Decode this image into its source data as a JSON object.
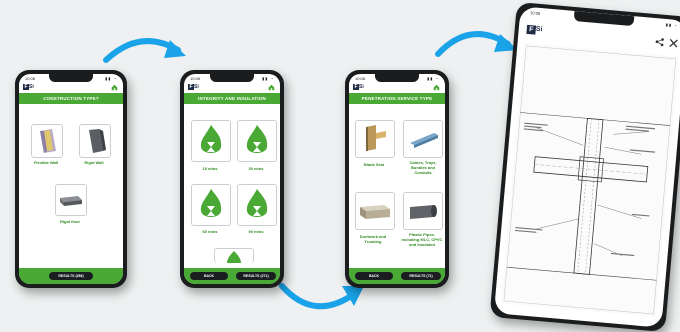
{
  "phone1": {
    "time": "10:08",
    "header": "CONSTRUCTION TYPE?",
    "tiles": [
      {
        "label": "Flexible Wall"
      },
      {
        "label": "Rigid Wall"
      },
      {
        "label": "Rigid floor"
      }
    ],
    "button": "RESULTS (286)"
  },
  "phone2": {
    "time": "10:08",
    "header": "INTEGRITY AND INSULATION",
    "tiles": [
      {
        "label": "15 mins"
      },
      {
        "label": "30 mins"
      },
      {
        "label": "60 mins"
      },
      {
        "label": "90 mins"
      }
    ],
    "back": "BACK",
    "button": "RESULTS (271)"
  },
  "phone3": {
    "time": "10:08",
    "header": "PENETRATION SERVICE TYPE",
    "tiles": [
      {
        "label": "Blank Seal"
      },
      {
        "label": "Cables, Trays, Bundles and Conduits"
      },
      {
        "label": "Ductwork and Trunking"
      },
      {
        "label": "Plastic Pipes, Including MLC, CPVC and Insulated"
      }
    ],
    "back": "BACK",
    "button": "RESULTS (71)"
  },
  "phone4": {
    "time": "10:08"
  },
  "colors": {
    "brand_green": "#4aa935",
    "arrow_blue": "#1aa3e8"
  }
}
